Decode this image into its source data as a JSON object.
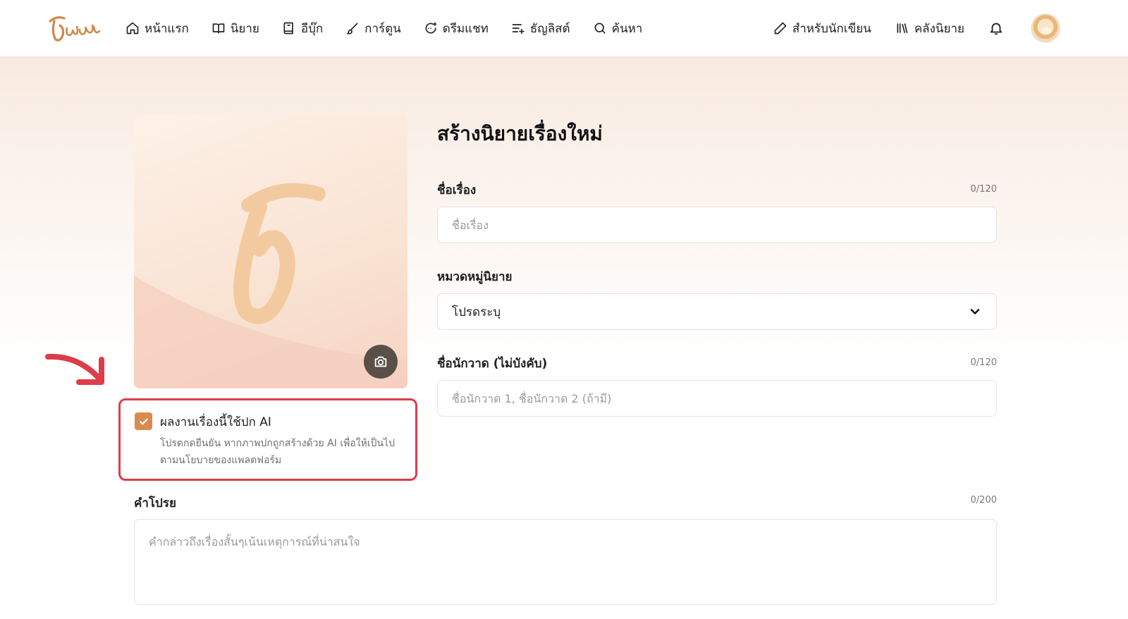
{
  "nav": {
    "items": [
      {
        "label": "หน้าแรก",
        "icon": "home-icon"
      },
      {
        "label": "นิยาย",
        "icon": "book-open-icon"
      },
      {
        "label": "อีบุ๊ก",
        "icon": "ebook-icon"
      },
      {
        "label": "การ์ตูน",
        "icon": "brush-icon"
      },
      {
        "label": "ดรีมแชท",
        "icon": "chat-sparkle-icon"
      },
      {
        "label": "ธัญลิสต์",
        "icon": "list-plus-icon"
      },
      {
        "label": "ค้นหา",
        "icon": "search-icon"
      }
    ],
    "writer": {
      "label": "สำหรับนักเขียน",
      "icon": "pencil-icon"
    },
    "library": {
      "label": "คลังนิยาย",
      "icon": "library-icon"
    }
  },
  "ai_checkbox": {
    "checked": true,
    "label": "ผลงานเรื่องนี้ใช้ปก AI",
    "description": "โปรดกดยืนยัน หากภาพปกถูกสร้างด้วย AI เพื่อให้เป็นไปตามนโยบายของแพลตฟอร์ม"
  },
  "form": {
    "title": "สร้างนิยายเรื่องใหม่",
    "name": {
      "label": "ชื่อเรื่อง",
      "counter": "0/120",
      "placeholder": "ชื่อเรื่อง"
    },
    "category": {
      "label": "หมวดหมู่นิยาย",
      "selected": "โปรดระบุ"
    },
    "illustrator": {
      "label": "ชื่อนักวาด (ไม่บังคับ)",
      "counter": "0/120",
      "placeholder": "ชื่อนักวาด 1, ชื่อนักวาด 2 (ถ้ามี)"
    },
    "synopsis": {
      "label": "คำโปรย",
      "counter": "0/200",
      "placeholder": "คำกล่าวถึงเรื่องสั้นๆเน้นเหตุการณ์ที่น่าสนใจ"
    }
  },
  "colors": {
    "accent": "#d98b4f",
    "highlight_border": "#dc3d4b",
    "camera_button": "#5a5048"
  }
}
